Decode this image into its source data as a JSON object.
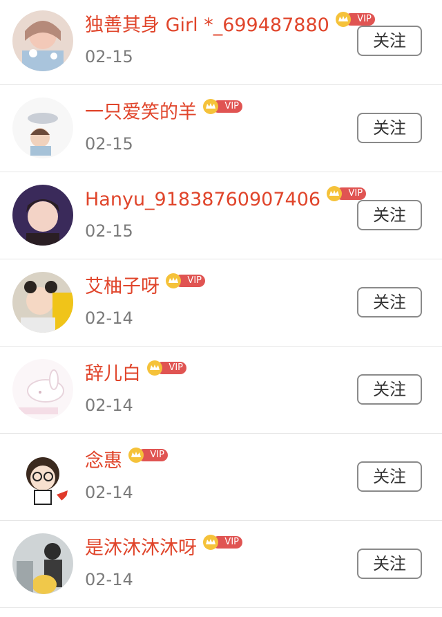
{
  "follow_label": "关注",
  "vip_label": "VIP",
  "colors": {
    "name": "#e0452b",
    "vip_badge": "#e05452",
    "crown": "#f5c23a",
    "date": "#7b7b7b"
  },
  "items": [
    {
      "name": "独善其身 Girl *_699487880",
      "date": "02-15"
    },
    {
      "name": "一只爱笑的羊",
      "date": "02-15"
    },
    {
      "name": "Hanyu_91838760907406",
      "date": "02-15"
    },
    {
      "name": "艾柚子呀",
      "date": "02-14"
    },
    {
      "name": "辞儿白",
      "date": "02-14"
    },
    {
      "name": "念惠",
      "date": "02-14"
    },
    {
      "name": "是沐沐沐沐呀",
      "date": "02-14"
    }
  ]
}
